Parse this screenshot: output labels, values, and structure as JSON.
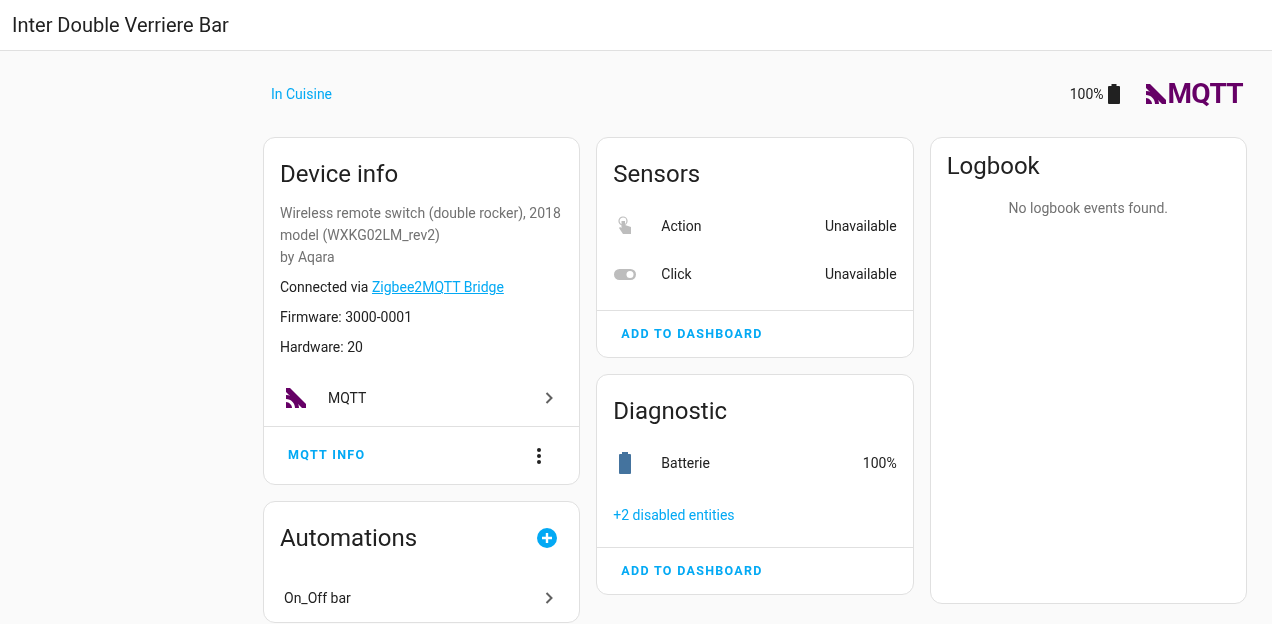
{
  "header": {
    "title": "Inter Double Verriere Bar"
  },
  "area_link": "In Cuisine",
  "top_battery": {
    "reading": "100%"
  },
  "logo": {
    "text": "MQTT"
  },
  "device_info": {
    "title": "Device info",
    "model": "Wireless remote switch (double rocker), 2018 model (WXKG02LM_rev2)",
    "manufacturer": "by Aqara",
    "connected_label": "Connected via",
    "connected_link": "Zigbee2MQTT Bridge",
    "firmware": "Firmware: 3000-0001",
    "hardware": "Hardware: 20",
    "integration": "MQTT",
    "action": "MQTT INFO"
  },
  "automations": {
    "title": "Automations",
    "items": [
      "On_Off bar"
    ]
  },
  "sensors": {
    "title": "Sensors",
    "entities": [
      {
        "kind": "touch",
        "name": "Action",
        "state": "Unavailable"
      },
      {
        "kind": "toggle",
        "name": "Click",
        "state": "Unavailable"
      }
    ],
    "action": "ADD TO DASHBOARD"
  },
  "diagnostic": {
    "title": "Diagnostic",
    "entities": [
      {
        "kind": "battery",
        "name": "Batterie",
        "state": "100%"
      }
    ],
    "disabled_link": "+2 disabled entities",
    "action": "ADD TO DASHBOARD"
  },
  "logbook": {
    "title": "Logbook",
    "empty": "No logbook events found."
  }
}
